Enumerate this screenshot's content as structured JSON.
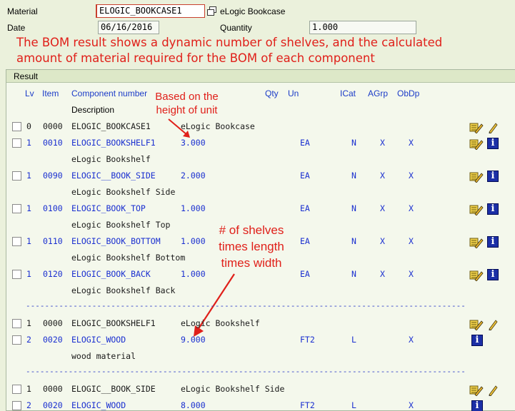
{
  "header": {
    "material_label": "Material",
    "material_value": "ELOGIC_BOOKCASE1",
    "material_desc": "eLogic Bookcase",
    "date_label": "Date",
    "date_value": "06/16/2016",
    "quantity_label": "Quantity",
    "quantity_value": "1.000"
  },
  "annotations": {
    "headline_line1": "The BOM result shows a dynamic number of shelves, and the calculated",
    "headline_line2": "amount of material required for the BOM of each component",
    "height_line1": "Based on the",
    "height_line2": "height of unit",
    "shelves_line1": "# of shelves",
    "shelves_line2": "times length",
    "shelves_line3": "times width",
    "color": "#e0201a"
  },
  "panel": {
    "title": "Result",
    "columns": {
      "lv": "Lv",
      "item": "Item",
      "component": "Component number",
      "qty": "Qty",
      "un": "Un",
      "icat": "ICat",
      "agrp": "AGrp",
      "obdp": "ObDp",
      "description": "Description"
    },
    "separator": "------------------------------------------------------------------------------------------------"
  },
  "rows": [
    {
      "lv": "0",
      "item": "0000",
      "component": "ELOGIC_BOOKCASE1",
      "qty": "eLogic Bookcase",
      "un": "",
      "icat": "",
      "agrp": "",
      "obdp": "",
      "desc": "",
      "style": "black",
      "icon": "display-change"
    },
    {
      "lv": "1",
      "item": "0010",
      "component": "ELOGIC_BOOKSHELF1",
      "qty": "3.000",
      "un": "EA",
      "icat": "N",
      "agrp": "X",
      "obdp": "X",
      "desc": "eLogic Bookshelf",
      "style": "blue",
      "icon": "info"
    },
    {
      "lv": "1",
      "item": "0090",
      "component": "ELOGIC__BOOK_SIDE",
      "qty": "2.000",
      "un": "EA",
      "icat": "N",
      "agrp": "X",
      "obdp": "X",
      "desc": "eLogic Bookshelf Side",
      "style": "blue",
      "icon": "info"
    },
    {
      "lv": "1",
      "item": "0100",
      "component": "ELOGIC_BOOK_TOP",
      "qty": "1.000",
      "un": "EA",
      "icat": "N",
      "agrp": "X",
      "obdp": "X",
      "desc": "eLogic Bookshelf Top",
      "style": "blue",
      "icon": "info"
    },
    {
      "lv": "1",
      "item": "0110",
      "component": "ELOGIC_BOOK_BOTTOM",
      "qty": "1.000",
      "un": "EA",
      "icat": "N",
      "agrp": "X",
      "obdp": "X",
      "desc": "eLogic Bookshelf Bottom",
      "style": "blue",
      "icon": "info"
    },
    {
      "lv": "1",
      "item": "0120",
      "component": "ELOGIC_BOOK_BACK",
      "qty": "1.000",
      "un": "EA",
      "icat": "N",
      "agrp": "X",
      "obdp": "X",
      "desc": "eLogic Bookshelf Back",
      "style": "blue",
      "icon": "info"
    },
    {
      "lv": "1",
      "item": "0000",
      "component": "ELOGIC_BOOKSHELF1",
      "qty": "eLogic Bookshelf",
      "un": "",
      "icat": "",
      "agrp": "",
      "obdp": "",
      "desc": "",
      "style": "black",
      "icon": "display-change"
    },
    {
      "lv": "2",
      "item": "0020",
      "component": "ELOGIC_WOOD",
      "qty": "9.000",
      "un": "FT2",
      "icat": "L",
      "agrp": "",
      "obdp": "X",
      "desc": "wood material",
      "style": "blue",
      "icon": "info-only"
    },
    {
      "lv": "1",
      "item": "0000",
      "component": "ELOGIC__BOOK_SIDE",
      "qty": "eLogic Bookshelf Side",
      "un": "",
      "icat": "",
      "agrp": "",
      "obdp": "",
      "desc": "",
      "style": "black",
      "icon": "display-change"
    },
    {
      "lv": "2",
      "item": "0020",
      "component": "ELOGIC_WOOD",
      "qty": "8.000",
      "un": "FT2",
      "icat": "L",
      "agrp": "",
      "obdp": "X",
      "desc": "",
      "style": "blue",
      "icon": "info-only"
    }
  ]
}
